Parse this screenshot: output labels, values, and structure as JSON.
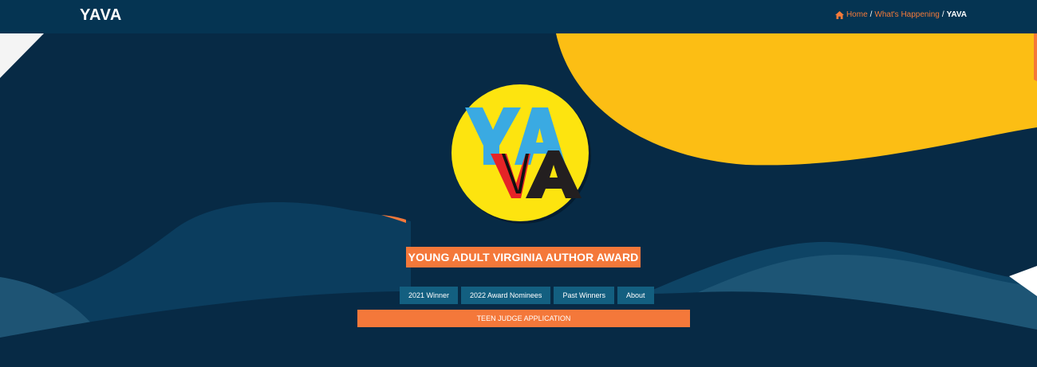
{
  "header": {
    "site_title": "YAVA",
    "breadcrumb": {
      "home": "Home",
      "sep1": "/",
      "section": "What's Happening",
      "sep2": "/",
      "current": "YAVA"
    }
  },
  "hero": {
    "logo": {
      "letters_top": "YA",
      "letters_bottom_v": "V",
      "letters_bottom_a": "A"
    },
    "award_title": "YOUNG ADULT VIRGINIA AUTHOR AWARD",
    "tabs": [
      {
        "label": "2021 Winner"
      },
      {
        "label": "2022 Award Nominees"
      },
      {
        "label": "Past Winners"
      },
      {
        "label": "About"
      }
    ],
    "cta_label": "TEEN JUDGE APPLICATION"
  },
  "colors": {
    "background": "#072a45",
    "topbar": "#053452",
    "accent": "#f4783a",
    "yellow_blob": "#fcbe14",
    "wave": "#0b3d5e",
    "tab": "#135f80"
  }
}
